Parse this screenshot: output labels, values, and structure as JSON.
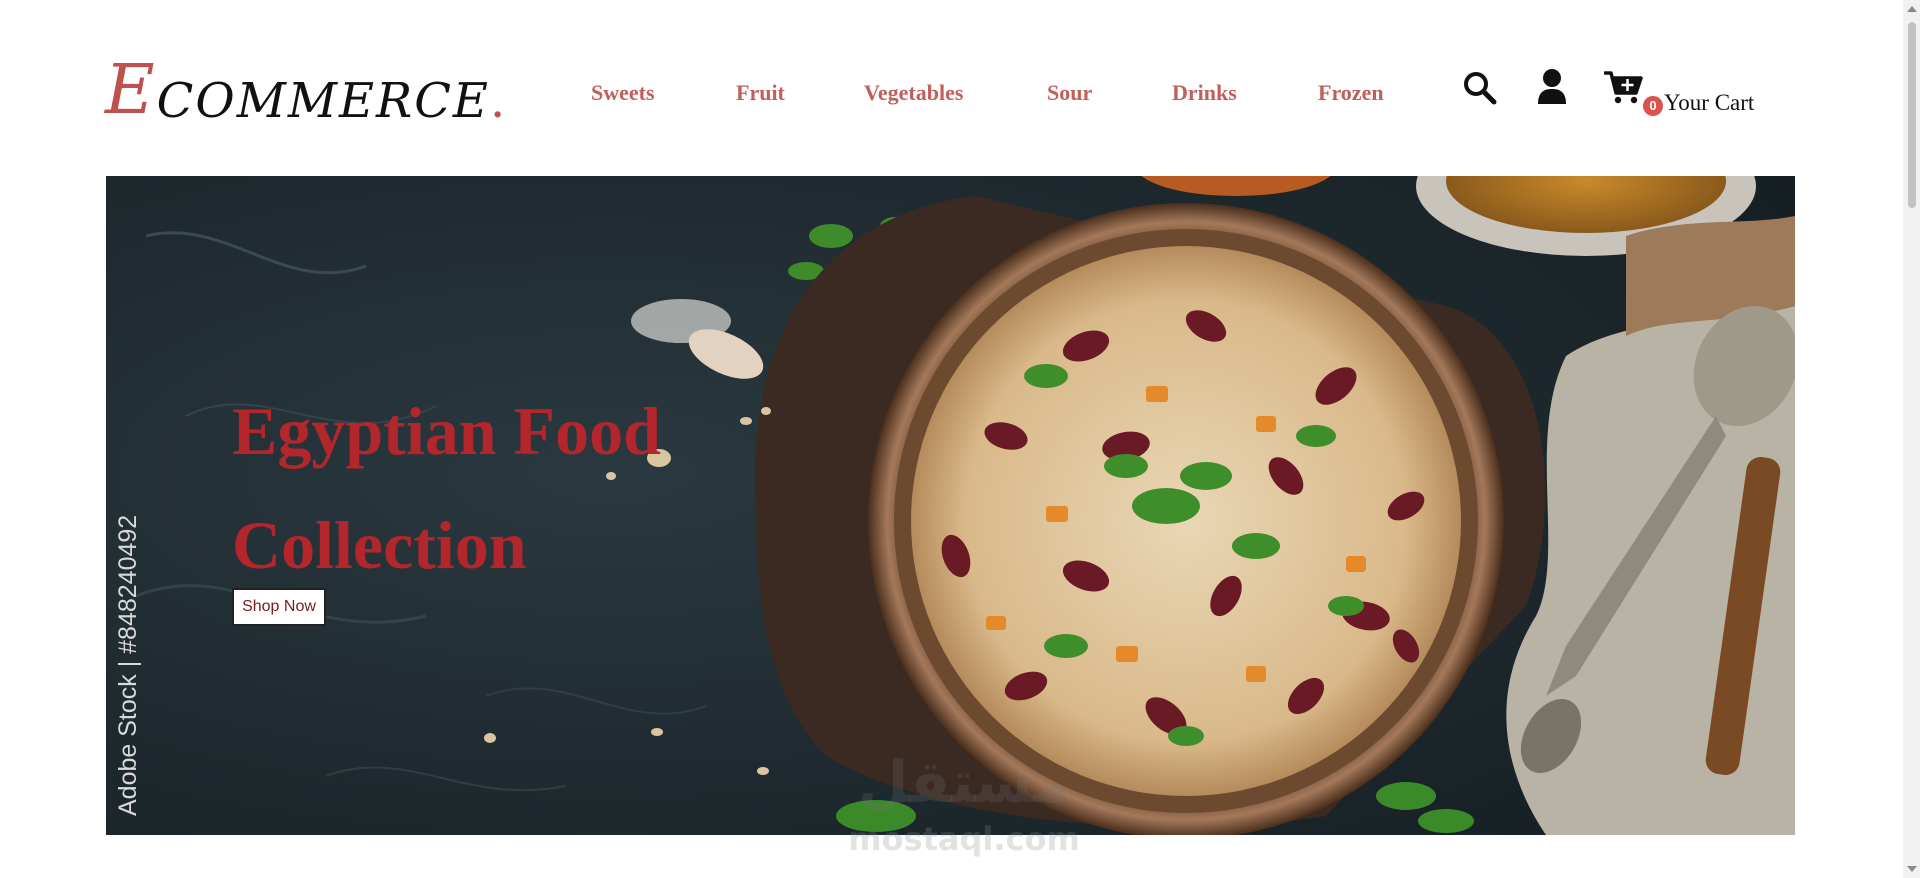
{
  "brand": {
    "logo_initial": "E",
    "logo_rest": "COMMERCE",
    "logo_dot": "."
  },
  "nav": {
    "items": [
      {
        "label": "Sweets"
      },
      {
        "label": "Fruit"
      },
      {
        "label": "Vegetables"
      },
      {
        "label": "Sour"
      },
      {
        "label": "Drinks"
      },
      {
        "label": "Frozen"
      }
    ]
  },
  "header_icons": [
    "search-icon",
    "user-icon",
    "cart-plus-icon"
  ],
  "cart": {
    "count": "0",
    "label": "Your Cart"
  },
  "hero": {
    "title": "Egyptian Food Collection",
    "cta_label": "Shop Now",
    "image_watermark": "Adobe Stock | #848240492"
  },
  "site_watermark": {
    "arabic": "مستقل",
    "latin": "mostaql.com"
  },
  "colors": {
    "accent": "#c0504d",
    "nav_text": "#c0605a",
    "hero_title": "#b3262c",
    "badge": "#d9534f",
    "hero_background": "#1f2b31"
  }
}
